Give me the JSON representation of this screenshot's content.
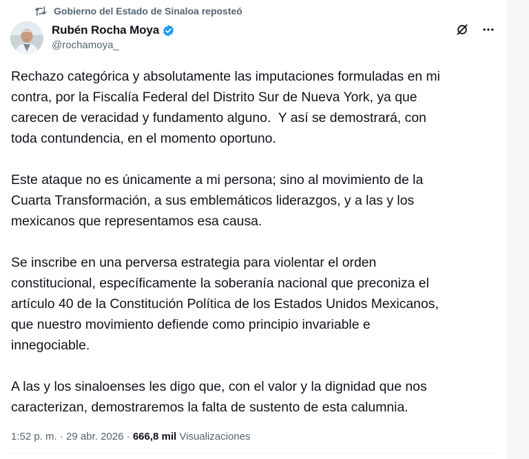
{
  "repost": {
    "text": "Gobierno del Estado de Sinaloa reposteó",
    "icon": "repost-icon"
  },
  "author": {
    "display_name": "Rubén Rocha Moya",
    "handle": "@rochamoya_",
    "verified": true,
    "verified_color": "#1d9bf0"
  },
  "actions": {
    "grok_icon": "grok-icon",
    "more_icon": "more-options-icon"
  },
  "post": {
    "paragraphs": [
      "Rechazo categórica y absolutamente las imputaciones formuladas en mi\ncontra, por la Fiscalía Federal del Distrito Sur de Nueva York, ya que\ncarecen de veracidad y fundamento alguno.  Y así se demostrará, con\ntoda contundencia, en el momento oportuno.",
      "Este ataque no es únicamente a mi persona; sino al movimiento de la\nCuarta Transformación, a sus emblemáticos liderazgos, y a las y los\nmexicanos que representamos esa causa.",
      "Se inscribe en una perversa estrategia para violentar el orden\nconstitucional, específicamente la soberanía nacional que preconiza el\nartículo 40 de la Constitución Política de los Estados Unidos Mexicanos,\nque nuestro movimiento defiende como principio invariable e\ninnegociable.",
      "A las y los sinaloenses les digo que, con el valor y la dignidad que nos\ncaracterizan, demostraremos la falta de sustento de esta calumnia."
    ]
  },
  "meta": {
    "time": "1:52 p. m.",
    "separator": " · ",
    "date": "29 abr. 2026",
    "views_count": "666,8 mil",
    "views_label": "Visualizaciones"
  }
}
